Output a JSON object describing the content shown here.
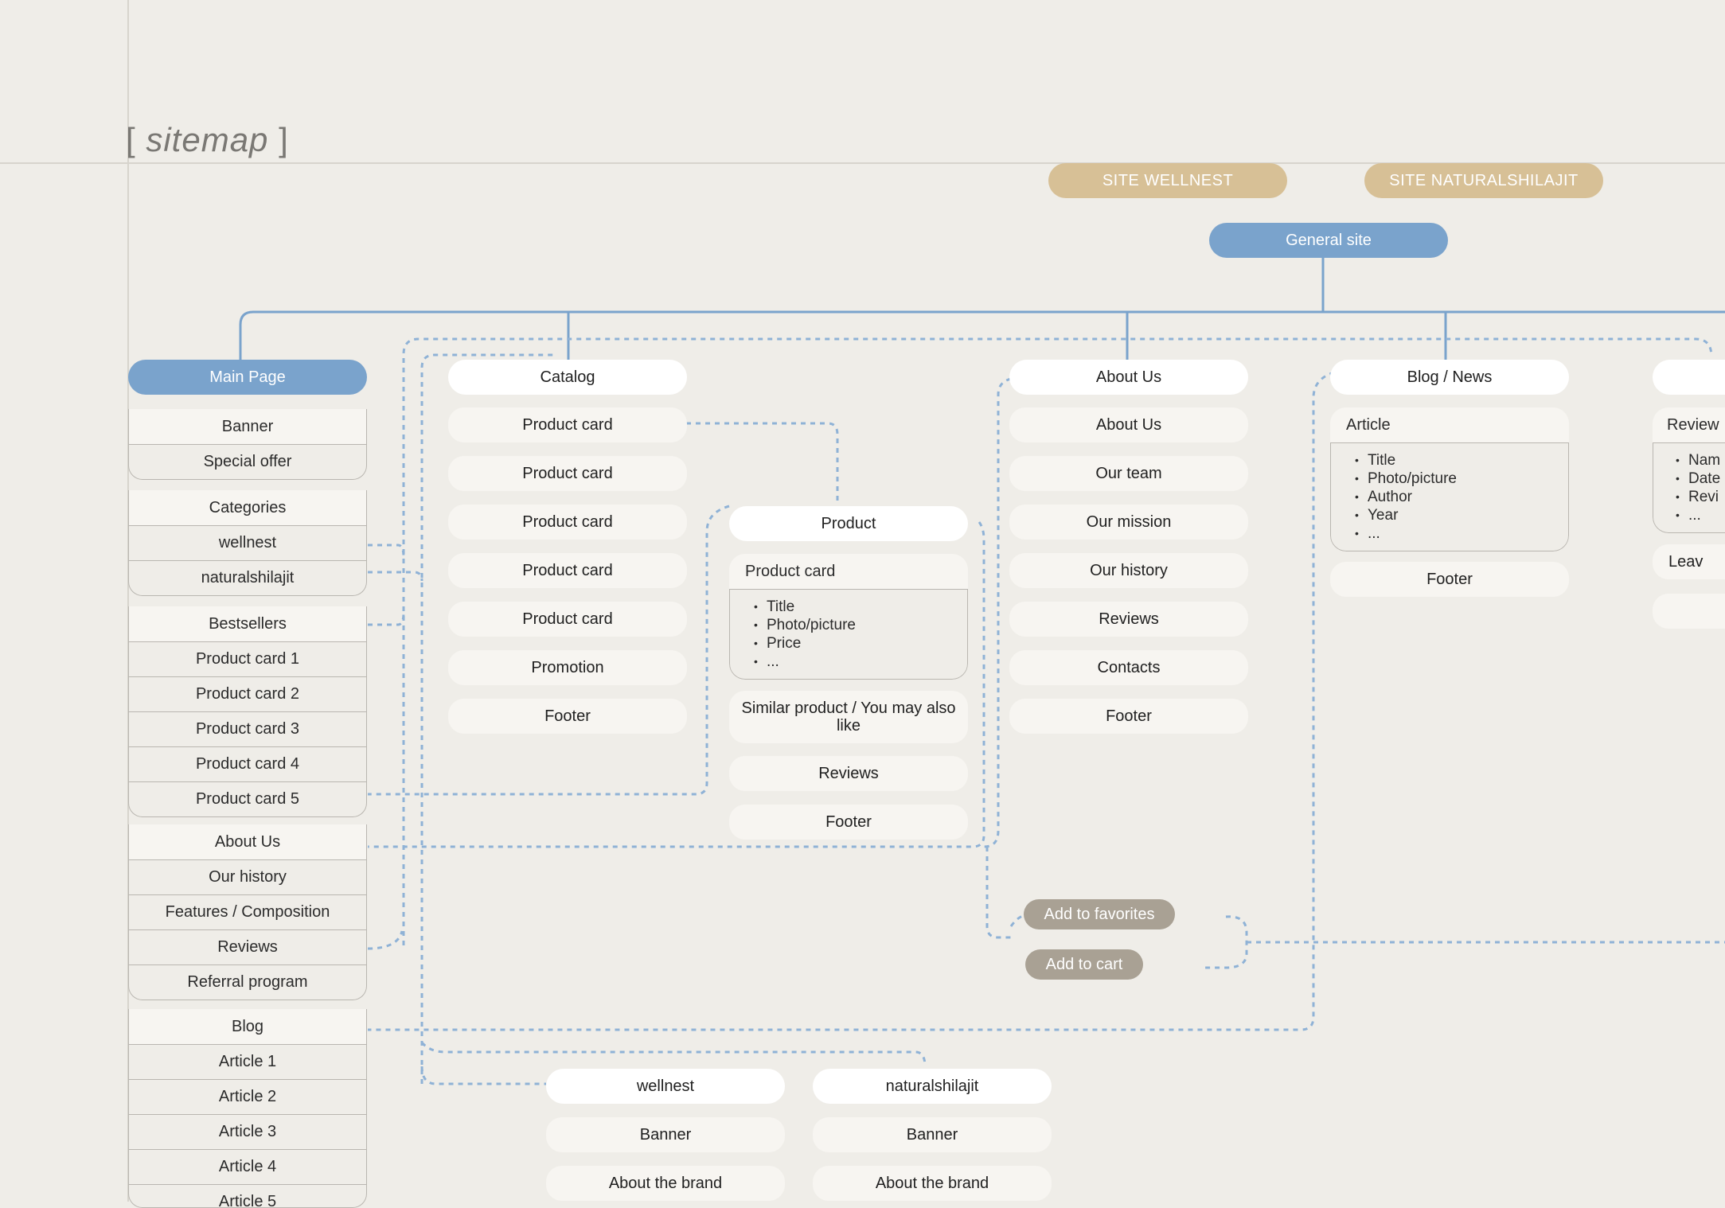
{
  "title": {
    "bracket_open": "[ ",
    "word": "sitemap",
    "bracket_close": " ]"
  },
  "sites": {
    "wellnest": "SITE WELLNEST",
    "naturalshilajit": "SITE NATURALSHILAJIT",
    "general": "General site"
  },
  "main_page": {
    "header": "Main Page",
    "banner_group": [
      "Banner",
      "Special offer"
    ],
    "categories": {
      "header": "Categories",
      "items": [
        "wellnest",
        "naturalshilajit"
      ]
    },
    "bestsellers": {
      "header": "Bestsellers",
      "items": [
        "Product card 1",
        "Product card 2",
        "Product card 3",
        "Product card 4",
        "Product card 5"
      ]
    },
    "about": {
      "header": "About Us",
      "items": [
        "Our history",
        "Features / Composition",
        "Reviews",
        "Referral program"
      ]
    },
    "blog": {
      "header": "Blog",
      "items": [
        "Article 1",
        "Article 2",
        "Article 3",
        "Article 4",
        "Article 5"
      ]
    }
  },
  "catalog": {
    "header": "Catalog",
    "items": [
      "Product card",
      "Product card",
      "Product card",
      "Product card",
      "Product card",
      "Promotion",
      "Footer"
    ]
  },
  "product": {
    "header": "Product",
    "card": {
      "head": "Product card",
      "bullets": [
        "Title",
        "Photo/picture",
        "Price",
        "..."
      ]
    },
    "items": [
      "Similar product / You may also like",
      "Reviews",
      "Footer"
    ]
  },
  "about_us": {
    "header": "About Us",
    "items": [
      "About Us",
      "Our team",
      "Our mission",
      "Our history",
      "Reviews",
      "Contacts",
      "Footer"
    ]
  },
  "blog_news": {
    "header": "Blog / News",
    "article": {
      "head": "Article",
      "bullets": [
        "Title",
        "Photo/picture",
        "Author",
        "Year",
        "..."
      ]
    },
    "footer": "Footer"
  },
  "reviews_col": {
    "head": "Review",
    "bullets": [
      "Nam",
      "Date",
      "Revi",
      "..."
    ],
    "leave": "Leav"
  },
  "actions": {
    "favorites": "Add to favorites",
    "cart": "Add to cart"
  },
  "brand_pages": [
    {
      "header": "wellnest",
      "items": [
        "Banner",
        "About the brand"
      ]
    },
    {
      "header": "naturalshilajit",
      "items": [
        "Banner",
        "About the brand"
      ]
    }
  ],
  "colors": {
    "blue": "#7aa3cc",
    "gold": "#d7c096",
    "grey_pill": "#a9a194",
    "background": "#efede8"
  }
}
